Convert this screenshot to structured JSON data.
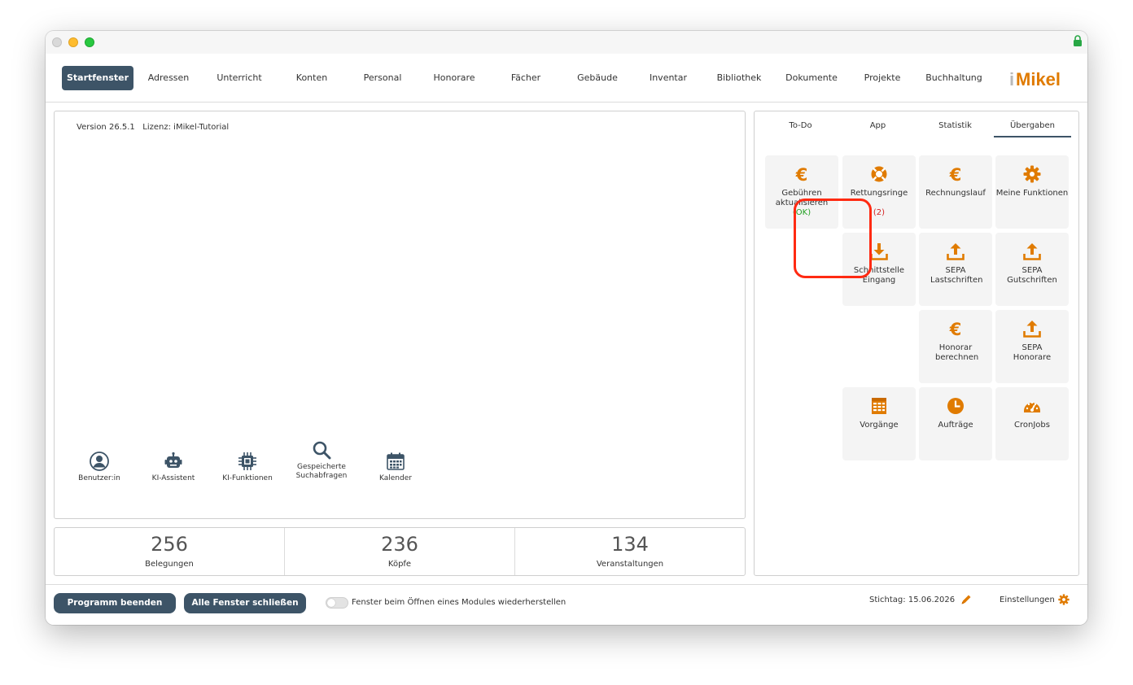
{
  "nav": {
    "items": [
      "Startfenster",
      "Adressen",
      "Unterricht",
      "Konten",
      "Personal",
      "Honorare",
      "Fächer",
      "Gebäude",
      "Inventar",
      "Bibliothek",
      "Dokumente",
      "Projekte",
      "Buchhaltung"
    ],
    "active": "Startfenster",
    "logo_text": "iMikel"
  },
  "left_panel": {
    "version_text": "Version 26.5.1   Lizenz: iMikel-Tutorial",
    "quick_actions": [
      {
        "label": "Benutzer:in",
        "icon": "user-icon"
      },
      {
        "label": "KI-Assistent",
        "icon": "robot-icon"
      },
      {
        "label": "KI-Funktionen",
        "icon": "chip-icon"
      },
      {
        "label": "Gespeicherte Suchabfragen",
        "icon": "search-icon"
      },
      {
        "label": "Kalender",
        "icon": "calendar-icon"
      }
    ]
  },
  "stats": [
    {
      "value": "256",
      "label": "Belegungen"
    },
    {
      "value": "236",
      "label": "Köpfe"
    },
    {
      "value": "134",
      "label": "Veranstaltungen"
    }
  ],
  "right_panel": {
    "tabs": [
      "To-Do",
      "App",
      "Statistik",
      "Übergaben"
    ],
    "active_tab": "Übergaben",
    "tiles": [
      {
        "label": "Gebühren aktualisieren",
        "status": "(OK)",
        "icon": "euro-icon"
      },
      {
        "label": "Rettungsringe",
        "status": "(2)",
        "icon": "lifebuoy-icon"
      },
      {
        "label": "Rechnungslauf",
        "icon": "euro-icon"
      },
      {
        "label": "Meine Funktionen",
        "icon": "gear-icon"
      },
      {
        "label": "Schnittstelle Eingang",
        "icon": "download-icon",
        "highlighted": true
      },
      {
        "label": "SEPA Lastschriften",
        "icon": "upload-icon"
      },
      {
        "label": "SEPA Gutschriften",
        "icon": "upload-icon"
      },
      {
        "label": "Honorar berechnen",
        "icon": "euro-icon"
      },
      {
        "label": "SEPA Honorare",
        "icon": "upload-icon"
      },
      {
        "label": "Vorgänge",
        "icon": "table-icon"
      },
      {
        "label": "Aufträge",
        "icon": "clock-icon"
      },
      {
        "label": "CronJobs",
        "icon": "gauge-icon"
      }
    ]
  },
  "footer": {
    "quit_label": "Programm beenden",
    "close_all_label": "Alle Fenster schließen",
    "restore_toggle_label": "Fenster beim Öffnen eines Modules wiederherstellen",
    "restore_toggle_on": false,
    "stichtag_text": "Stichtag: 15.06.2026",
    "settings_label": "Einstellungen"
  },
  "colors": {
    "accent_dark": "#3d5467",
    "icon_orange": "#e07b00",
    "highlight_red": "#ff2a12",
    "ok_green": "#22a022",
    "alert_red": "#d42020"
  }
}
